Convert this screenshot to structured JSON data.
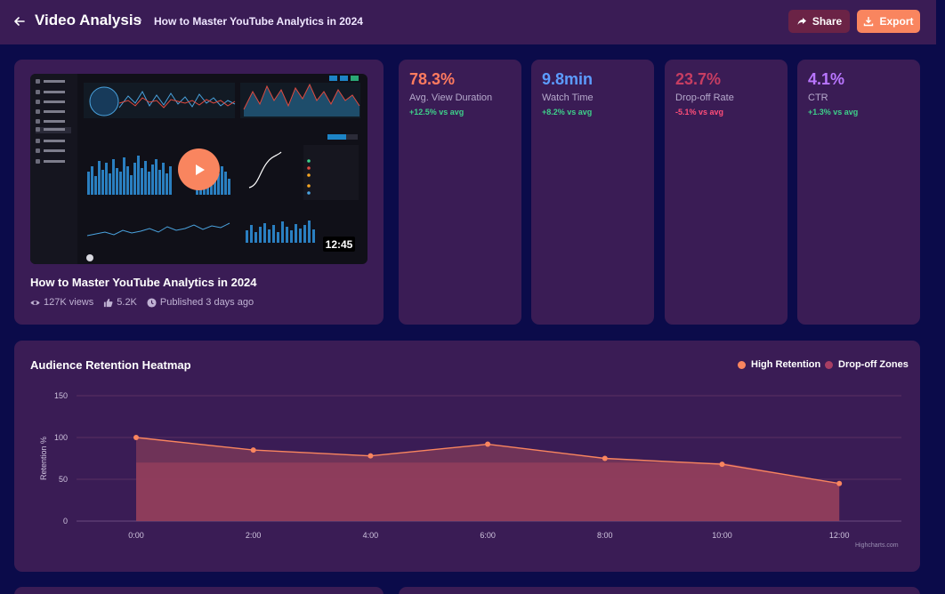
{
  "header": {
    "title": "Video Analysis",
    "separator": "•",
    "subtitle": "How to Master YouTube Analytics in 2024",
    "share_label": "Share",
    "export_label": "Export"
  },
  "video": {
    "title": "How to Master YouTube Analytics in 2024",
    "duration": "12:45",
    "views": "127K views",
    "likes": "5.2K",
    "published": "Published 3 days ago"
  },
  "kpis": [
    {
      "value": "78.3%",
      "label": "Avg. View Duration",
      "delta": "+12.5% vs avg",
      "color": "#ff7b5f",
      "delta_color": "#3ed08a"
    },
    {
      "value": "9.8min",
      "label": "Watch Time",
      "delta": "+8.2% vs avg",
      "color": "#5c9cff",
      "delta_color": "#3ed08a"
    },
    {
      "value": "23.7%",
      "label": "Drop-off Rate",
      "delta": "-5.1% vs avg",
      "color": "#c73d62",
      "delta_color": "#ff4d79"
    },
    {
      "value": "4.1%",
      "label": "CTR",
      "delta": "+1.3% vs avg",
      "color": "#b976ff",
      "delta_color": "#3ed08a"
    }
  ],
  "heatmap": {
    "title": "Audience Retention Heatmap",
    "legend": [
      {
        "name": "High Retention",
        "color": "#f9855f"
      },
      {
        "name": "Drop-off Zones",
        "color": "#a83e63"
      }
    ],
    "credits": "Highcharts.com"
  },
  "chart_data": {
    "type": "area",
    "title": "Audience Retention Heatmap",
    "xlabel": "",
    "ylabel": "Retention %",
    "categories": [
      "0:00",
      "2:00",
      "4:00",
      "6:00",
      "8:00",
      "10:00",
      "12:00"
    ],
    "yticks": [
      0,
      50,
      100,
      150
    ],
    "ylim": [
      0,
      150
    ],
    "series": [
      {
        "name": "High Retention",
        "values": [
          100,
          85,
          78,
          92,
          75,
          68,
          45
        ],
        "color": "#f9855f"
      },
      {
        "name": "Drop-off Zones",
        "values": [
          70,
          70,
          70,
          70,
          70,
          70,
          45
        ],
        "color": "#a83e63"
      }
    ],
    "grid": true,
    "legend_position": "top-right"
  },
  "colors": {
    "page_bg": "#0b0b4a",
    "card_bg": "#3a1c55",
    "accent": "#f9855f",
    "share_bg": "#6b2346"
  }
}
